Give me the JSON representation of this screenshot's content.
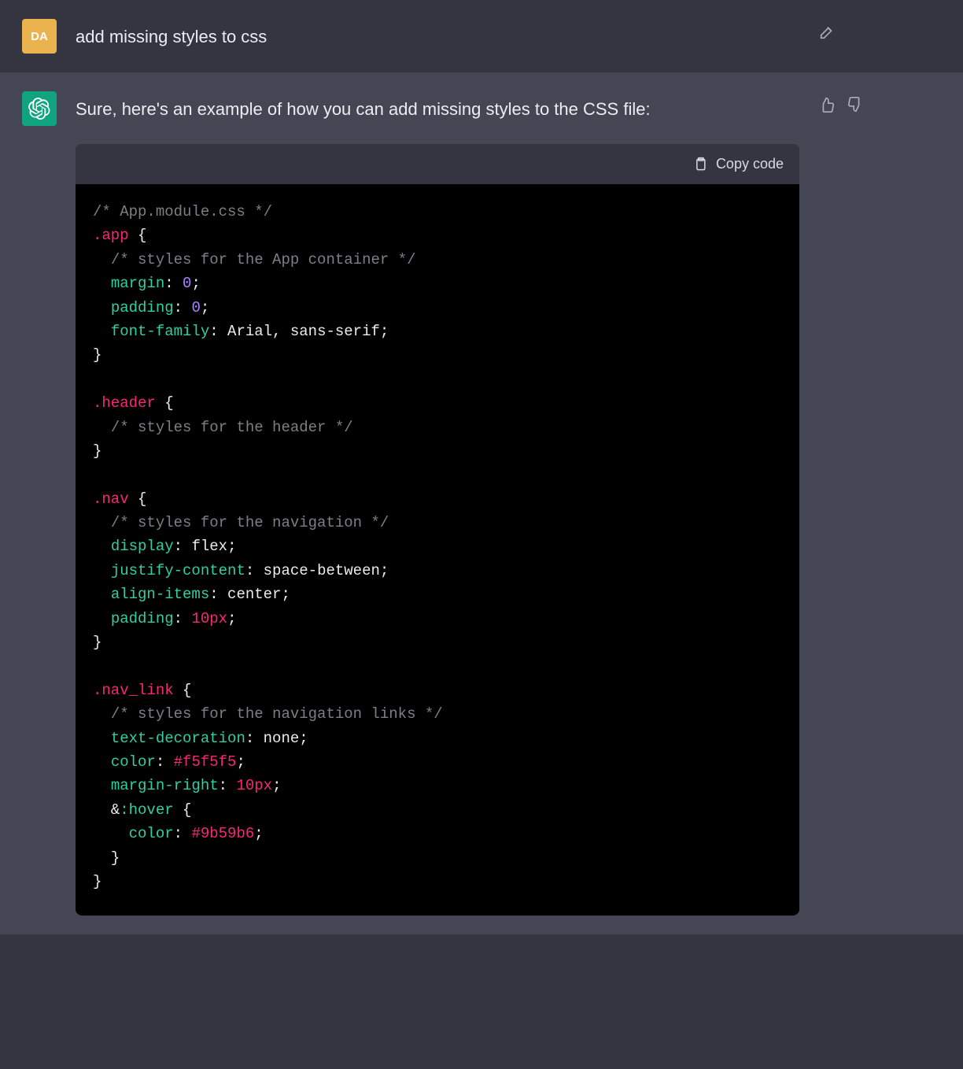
{
  "user": {
    "initials": "DA",
    "message": "add missing styles to css"
  },
  "assistant": {
    "intro": "Sure, here's an example of how you can add missing styles to the CSS file:",
    "copy_label": "Copy code",
    "code": {
      "c1": "/* App.module.css */",
      "sel_app": ".app",
      "c_app": "/* styles for the App container */",
      "p_margin": "margin",
      "v_zero_a": "0",
      "p_padding": "padding",
      "v_zero_b": "0",
      "p_fontfam": "font-family",
      "v_fontfam": "Arial, sans-serif",
      "sel_header": ".header",
      "c_header": "/* styles for the header */",
      "sel_nav": ".nav",
      "c_nav": "/* styles for the navigation */",
      "p_display": "display",
      "v_flex": "flex",
      "p_justify": "justify-content",
      "v_spacebetween": "space-between",
      "p_align": "align-items",
      "v_center": "center",
      "p_padding2": "padding",
      "v_10px": "10px",
      "sel_navlink": ".nav_link",
      "c_navlink": "/* styles for the navigation links */",
      "p_textdec": "text-decoration",
      "v_none": "none",
      "p_color": "color",
      "v_f5": "#f5f5f5",
      "p_mr": "margin-right",
      "v_10px_b": "10px",
      "amp": "&",
      "ps_hover": ":hover",
      "p_color2": "color",
      "v_9b": "#9b59b6"
    }
  }
}
